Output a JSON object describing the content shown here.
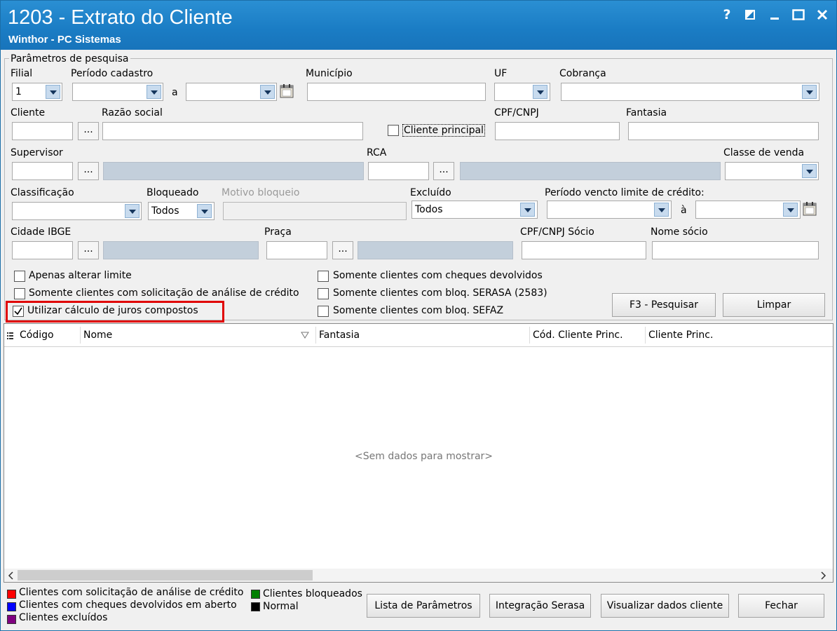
{
  "window": {
    "title": "1203 - Extrato do Cliente",
    "subtitle": "Winthor - PC Sistemas",
    "help": "?"
  },
  "filters": {
    "group_title": "Parâmetros de pesquisa",
    "filial": {
      "label": "Filial",
      "value": "1"
    },
    "periodo_cadastro": {
      "label": "Período cadastro",
      "sep": "a"
    },
    "municipio": {
      "label": "Município"
    },
    "uf": {
      "label": "UF"
    },
    "cobranca": {
      "label": "Cobrança"
    },
    "cliente": {
      "label": "Cliente"
    },
    "razao_social": {
      "label": "Razão social"
    },
    "cliente_principal": {
      "label": "Cliente principal"
    },
    "cpf_cnpj": {
      "label": "CPF/CNPJ"
    },
    "fantasia": {
      "label": "Fantasia"
    },
    "supervisor": {
      "label": "Supervisor"
    },
    "rca": {
      "label": "RCA"
    },
    "classe_venda": {
      "label": "Classe de venda"
    },
    "classificacao": {
      "label": "Classificação"
    },
    "bloqueado": {
      "label": "Bloqueado",
      "value": "Todos"
    },
    "motivo_bloqueio": {
      "label": "Motivo bloqueio"
    },
    "excluido": {
      "label": "Excluído",
      "value": "Todos"
    },
    "periodo_vencto": {
      "label": "Período vencto limite de crédito:",
      "sep": "à"
    },
    "cidade_ibge": {
      "label": "Cidade IBGE"
    },
    "praca": {
      "label": "Praça"
    },
    "cpf_cnpj_socio": {
      "label": "CPF/CNPJ Sócio"
    },
    "nome_socio": {
      "label": "Nome sócio"
    },
    "ellipsis": "..."
  },
  "checkboxes": [
    {
      "label": "Apenas alterar limite",
      "checked": false
    },
    {
      "label": "Somente clientes com solicitação de análise de crédito",
      "checked": false
    },
    {
      "label": "Utilizar cálculo de juros compostos",
      "checked": true
    },
    {
      "label": "Somente clientes com cheques devolvidos",
      "checked": false
    },
    {
      "label": "Somente clientes com bloq. SERASA (2583)",
      "checked": false
    },
    {
      "label": "Somente clientes com bloq. SEFAZ",
      "checked": false
    }
  ],
  "actions": {
    "pesquisar": "F3 - Pesquisar",
    "limpar": "Limpar"
  },
  "grid": {
    "columns": [
      "Código",
      "Nome",
      "Fantasia",
      "Cód. Cliente Princ.",
      "Cliente Princ."
    ],
    "empty_text": "<Sem dados para mostrar>"
  },
  "legend": [
    {
      "label": "Clientes com solicitação de análise de crédito",
      "color": "#ff0000"
    },
    {
      "label": "Clientes com cheques devolvidos em aberto",
      "color": "#0000ff"
    },
    {
      "label": "Clientes excluídos",
      "color": "#800080"
    },
    {
      "label": "Clientes bloqueados",
      "color": "#008000"
    },
    {
      "label": "Normal",
      "color": "#000000"
    }
  ],
  "footer_buttons": {
    "lista": "Lista de Parâmetros",
    "integracao": "Integração Serasa",
    "visualizar": "Visualizar dados cliente",
    "fechar": "Fechar"
  },
  "highlight_color": "#e00000"
}
